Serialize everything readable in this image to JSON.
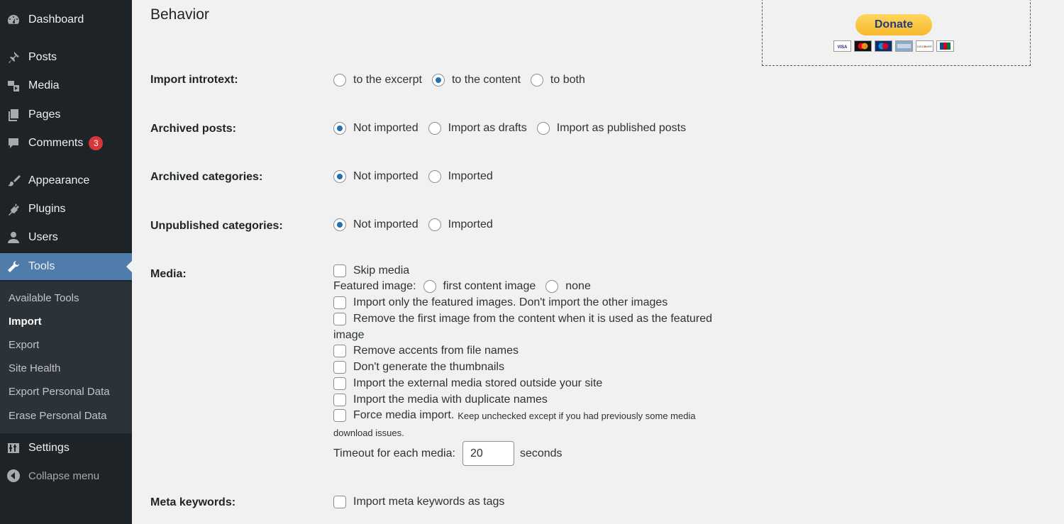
{
  "sidebar": {
    "items": [
      {
        "label": "Dashboard",
        "icon": "dashboard-icon"
      },
      {
        "label": "Posts",
        "icon": "pin-icon"
      },
      {
        "label": "Media",
        "icon": "media-icon"
      },
      {
        "label": "Pages",
        "icon": "pages-icon"
      },
      {
        "label": "Comments",
        "icon": "comment-icon",
        "badge": "3"
      },
      {
        "label": "Appearance",
        "icon": "brush-icon"
      },
      {
        "label": "Plugins",
        "icon": "plug-icon"
      },
      {
        "label": "Users",
        "icon": "user-icon"
      },
      {
        "label": "Tools",
        "icon": "wrench-icon",
        "active": true
      },
      {
        "label": "Settings",
        "icon": "sliders-icon"
      },
      {
        "label": "Collapse menu",
        "icon": "collapse-icon"
      }
    ],
    "submenu": [
      "Available Tools",
      "Import",
      "Export",
      "Site Health",
      "Export Personal Data",
      "Erase Personal Data"
    ],
    "submenu_current": "Import"
  },
  "main": {
    "heading": "Behavior",
    "introtext": {
      "label": "Import introtext:",
      "options": [
        "to the excerpt",
        "to the content",
        "to both"
      ],
      "selected": "to the content"
    },
    "archived_posts": {
      "label": "Archived posts:",
      "options": [
        "Not imported",
        "Import as drafts",
        "Import as published posts"
      ],
      "selected": "Not imported"
    },
    "archived_categories": {
      "label": "Archived categories:",
      "options": [
        "Not imported",
        "Imported"
      ],
      "selected": "Not imported"
    },
    "unpublished_categories": {
      "label": "Unpublished categories:",
      "options": [
        "Not imported",
        "Imported"
      ],
      "selected": "Not imported"
    },
    "media": {
      "label": "Media:",
      "skip_media": "Skip media",
      "featured_label": "Featured image:",
      "featured_options": [
        "first content image",
        "none"
      ],
      "only_featured": "Import only the featured images. Don't import the other images",
      "remove_first_a": "Remove the first image from the content when it is used as the featured",
      "remove_first_b": "image",
      "remove_accents": "Remove accents from file names",
      "no_thumbnails": "Don't generate the thumbnails",
      "external_media": "Import the external media stored outside your site",
      "duplicate_names": "Import the media with duplicate names",
      "force_import": "Force media import.",
      "force_note_a": "Keep unchecked except if you had previously some media",
      "force_note_b": "download issues.",
      "timeout_label": "Timeout for each media:",
      "timeout_value": "20",
      "timeout_unit": "seconds"
    },
    "meta_keywords": {
      "label": "Meta keywords:",
      "option": "Import meta keywords as tags"
    }
  },
  "donate": {
    "button": "Donate",
    "cards": [
      "VISA",
      "MC",
      "Maestro",
      "AMEX",
      "DISCOVER",
      "JCB"
    ]
  },
  "colors": {
    "sidebar_bg": "#1d2327",
    "active_bg": "#4f7cab",
    "badge": "#d63638",
    "donate_yellow": "#ffc439"
  }
}
